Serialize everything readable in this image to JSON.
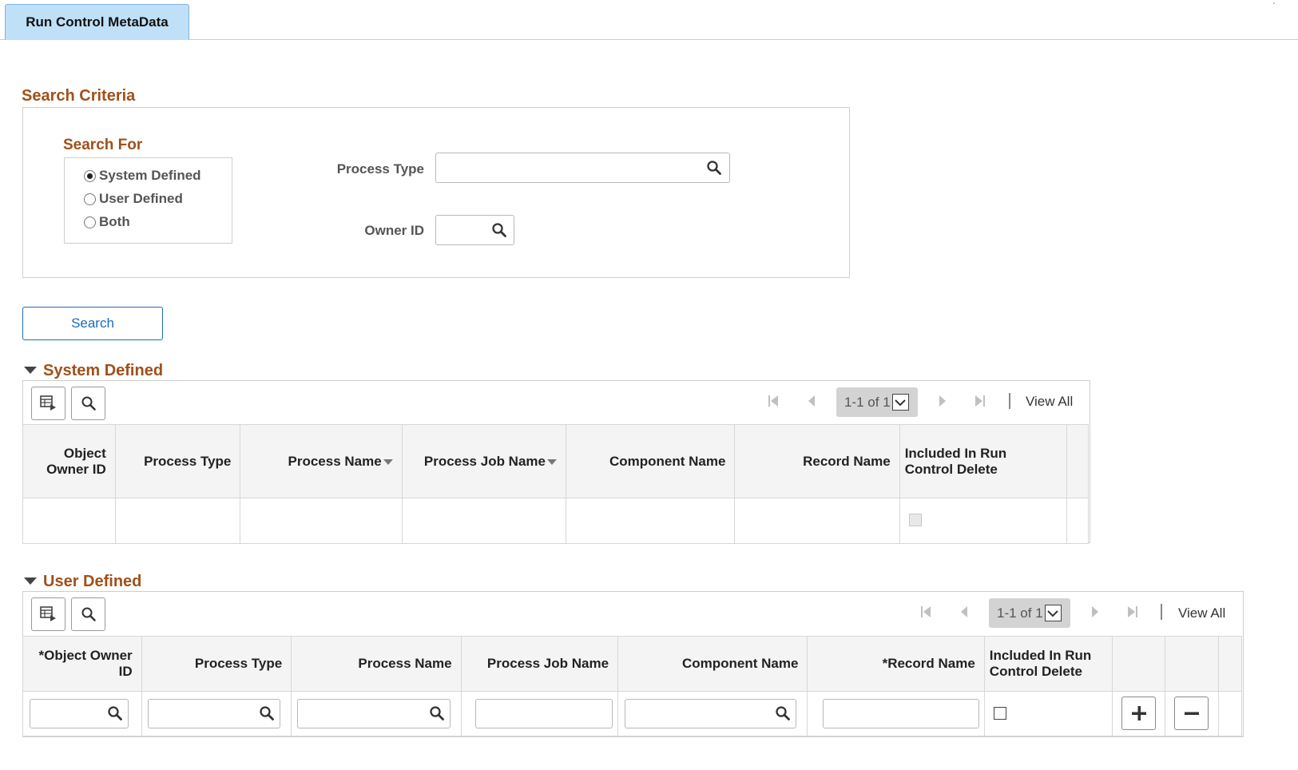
{
  "tabs": [
    {
      "label": "Run Control MetaData",
      "active": true
    }
  ],
  "search_criteria": {
    "title": "Search Criteria",
    "search_for": {
      "title": "Search For",
      "options": [
        "System Defined",
        "User Defined",
        "Both"
      ],
      "selected": "System Defined"
    },
    "process_type": {
      "label": "Process Type",
      "value": ""
    },
    "owner_id": {
      "label": "Owner ID",
      "value": ""
    }
  },
  "search_button": "Search",
  "system_defined": {
    "title": "System Defined",
    "pager": {
      "text": "1-1 of 1",
      "view_all": "View All"
    },
    "columns": [
      "Object Owner ID",
      "Process Type",
      "Process Name",
      "Process Job Name",
      "Component Name",
      "Record Name",
      "Included In Run Control Delete"
    ],
    "rows": [
      {
        "included_in_run_control_delete": false
      }
    ]
  },
  "user_defined": {
    "title": "User Defined",
    "pager": {
      "text": "1-1 of 1",
      "view_all": "View All"
    },
    "columns": [
      "*Object Owner ID",
      "Process Type",
      "Process Name",
      "Process Job Name",
      "Component Name",
      "*Record Name",
      "Included In Run Control Delete"
    ],
    "rows": [
      {
        "included_in_run_control_delete": false
      }
    ]
  },
  "colors": {
    "section_title": "#a0501a",
    "tab_bg": "#bfe0f7",
    "link": "#1a6bbd"
  },
  "icons": [
    "search-icon",
    "grid-personalize-icon",
    "first-page-icon",
    "previous-page-icon",
    "next-page-icon",
    "last-page-icon",
    "chevron-down-icon",
    "plus-icon",
    "minus-icon",
    "collapse-triangle-icon"
  ]
}
